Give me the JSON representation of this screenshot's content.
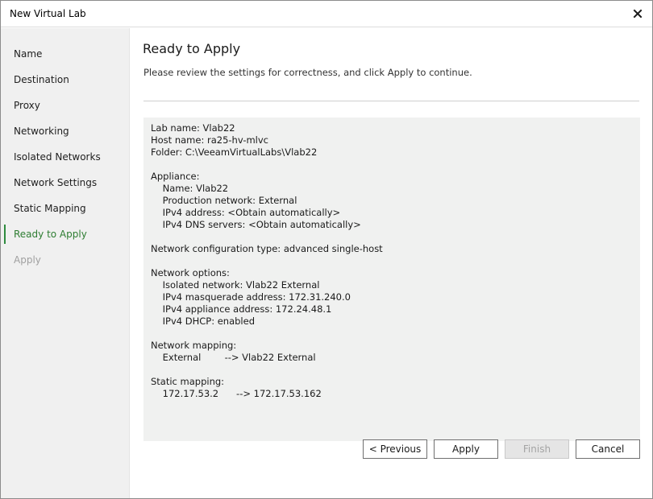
{
  "window": {
    "title": "New Virtual Lab"
  },
  "icons": {
    "close": "close-icon"
  },
  "sidebar": {
    "items": [
      {
        "label": "Name",
        "state": "normal"
      },
      {
        "label": "Destination",
        "state": "normal"
      },
      {
        "label": "Proxy",
        "state": "normal"
      },
      {
        "label": "Networking",
        "state": "normal"
      },
      {
        "label": "Isolated Networks",
        "state": "normal"
      },
      {
        "label": "Network Settings",
        "state": "normal"
      },
      {
        "label": "Static Mapping",
        "state": "normal"
      },
      {
        "label": "Ready to Apply",
        "state": "active"
      },
      {
        "label": "Apply",
        "state": "disabled"
      }
    ]
  },
  "main": {
    "heading": "Ready to Apply",
    "subheading": "Please review the settings for correctness, and click Apply to continue.",
    "summary": "Lab name: Vlab22\nHost name: ra25-hv-mlvc\nFolder: C:\\VeeamVirtualLabs\\Vlab22\n\nAppliance:\n    Name: Vlab22\n    Production network: External\n    IPv4 address: <Obtain automatically>\n    IPv4 DNS servers: <Obtain automatically>\n\nNetwork configuration type: advanced single-host\n\nNetwork options:\n    Isolated network: Vlab22 External\n    IPv4 masquerade address: 172.31.240.0\n    IPv4 appliance address: 172.24.48.1\n    IPv4 DHCP: enabled\n\nNetwork mapping:\n    External        --> Vlab22 External\n\nStatic mapping:\n    172.17.53.2      --> 172.17.53.162"
  },
  "buttons": {
    "previous": "< Previous",
    "apply": "Apply",
    "finish": "Finish",
    "cancel": "Cancel"
  },
  "colors": {
    "active_nav": "#2e7d32",
    "sidebar_bg": "#f0f0f0",
    "summary_bg": "#f0f1f0",
    "disabled_text": "#a0a0a0"
  }
}
